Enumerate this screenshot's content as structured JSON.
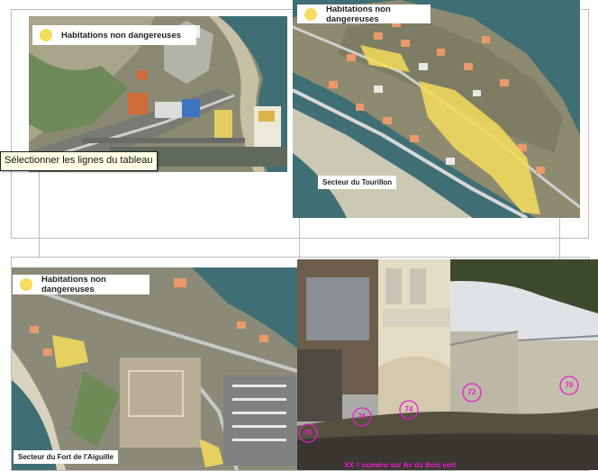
{
  "tooltip": "Sélectionner les lignes du tableau",
  "legend_label": "Habitations non dangereuses",
  "sectors": {
    "tourillon": "Secteur du Tourillon",
    "fort": "Secteur du Fort de l'Aiguille"
  },
  "house_numbers": [
    "76",
    "74",
    "72",
    "70",
    "78"
  ],
  "photo_caption": "XX = numéro sur Av du Bois vert",
  "colors": {
    "highlight": "#f6dc5c",
    "marker": "#e61ecb",
    "sea": "#3f6f74"
  }
}
